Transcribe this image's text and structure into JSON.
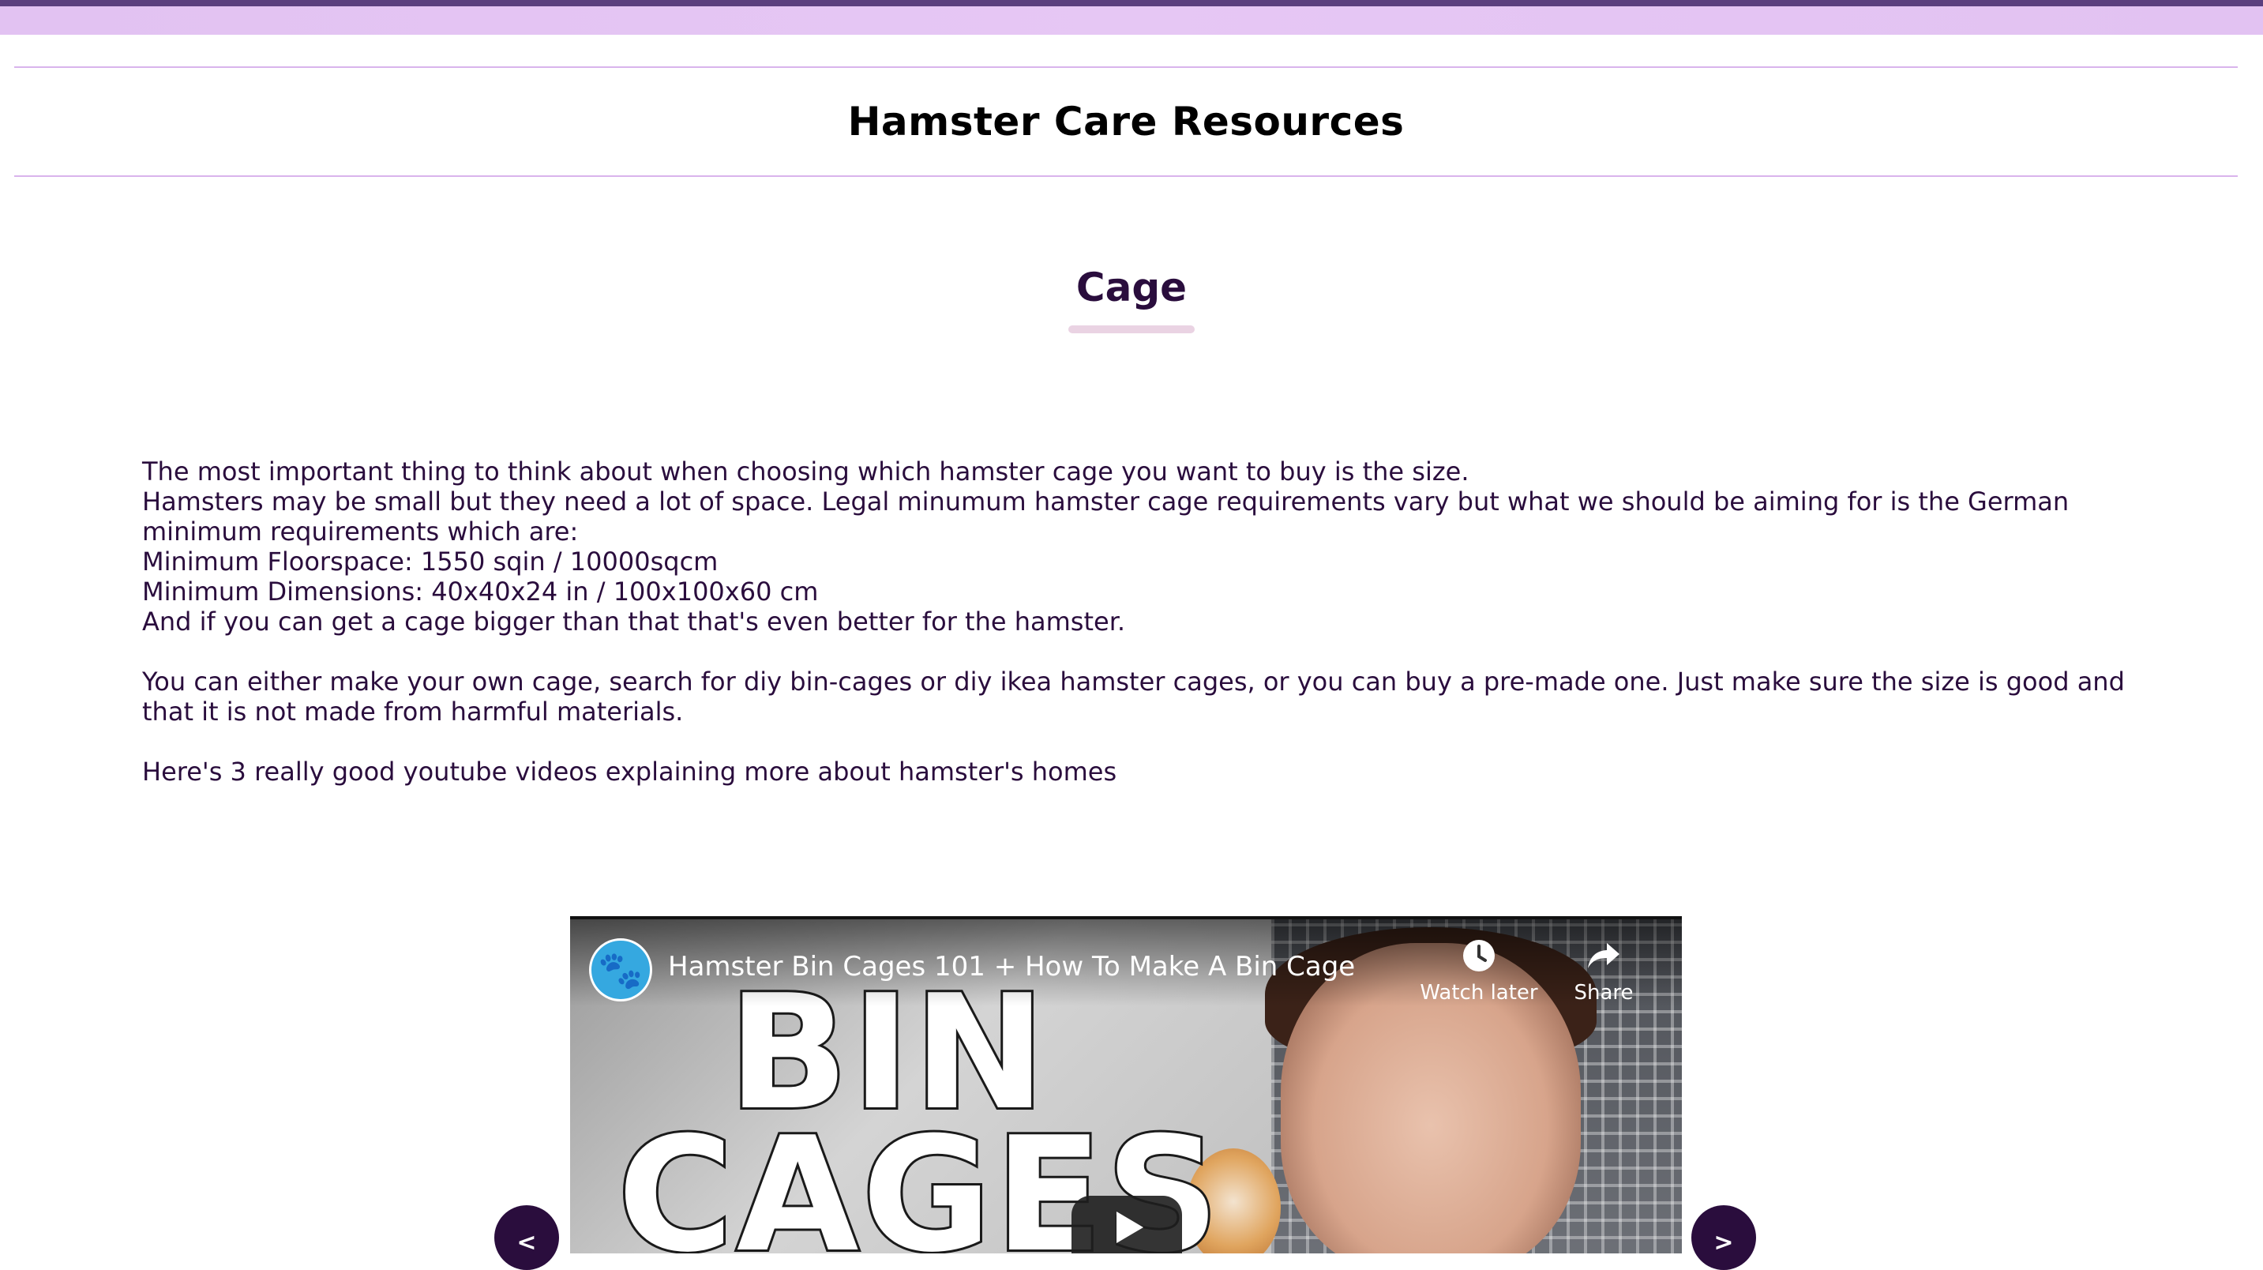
{
  "header": {
    "site_title": "Hamster Care Resources"
  },
  "section": {
    "title": "Cage"
  },
  "content": {
    "paragraph1_lines": [
      "The most important thing to think about when choosing which hamster cage you want to buy is the size.",
      "Hamsters may be small but they need a lot of space. Legal minumum hamster cage requirements vary but what we should be aiming for is the German minimum requirements which are:",
      "Minimum Floorspace: 1550 sqin / 10000sqcm",
      "Minimum Dimensions: 40x40x24 in / 100x100x60 cm",
      "And if you can get a cage bigger than that that's even better for the hamster."
    ],
    "paragraph2": "You can either make your own cage, search for diy bin-cages or diy ikea hamster cages, or you can buy a pre-made one. Just make sure the size is good and that it is not made from harmful materials.",
    "paragraph3": "Here's 3 really good youtube videos explaining more about hamster's homes"
  },
  "video": {
    "title": "Hamster Bin Cages 101 + How To Make A Bin Cage",
    "watch_later_label": "Watch later",
    "share_label": "Share",
    "thumbnail_text_line1": "BIN",
    "thumbnail_text_line2": "CAGES",
    "channel_icon": "paw-icon",
    "play_icon": "play-icon"
  },
  "carousel": {
    "prev_label": "<",
    "next_label": ">"
  },
  "colors": {
    "top_bar": "#5b3f7e",
    "top_band": "#e6c7f4",
    "header_border": "#d9b4ec",
    "text": "#2a0d3d",
    "underline": "#ead3e3",
    "nav_button": "#2a0d3d"
  }
}
